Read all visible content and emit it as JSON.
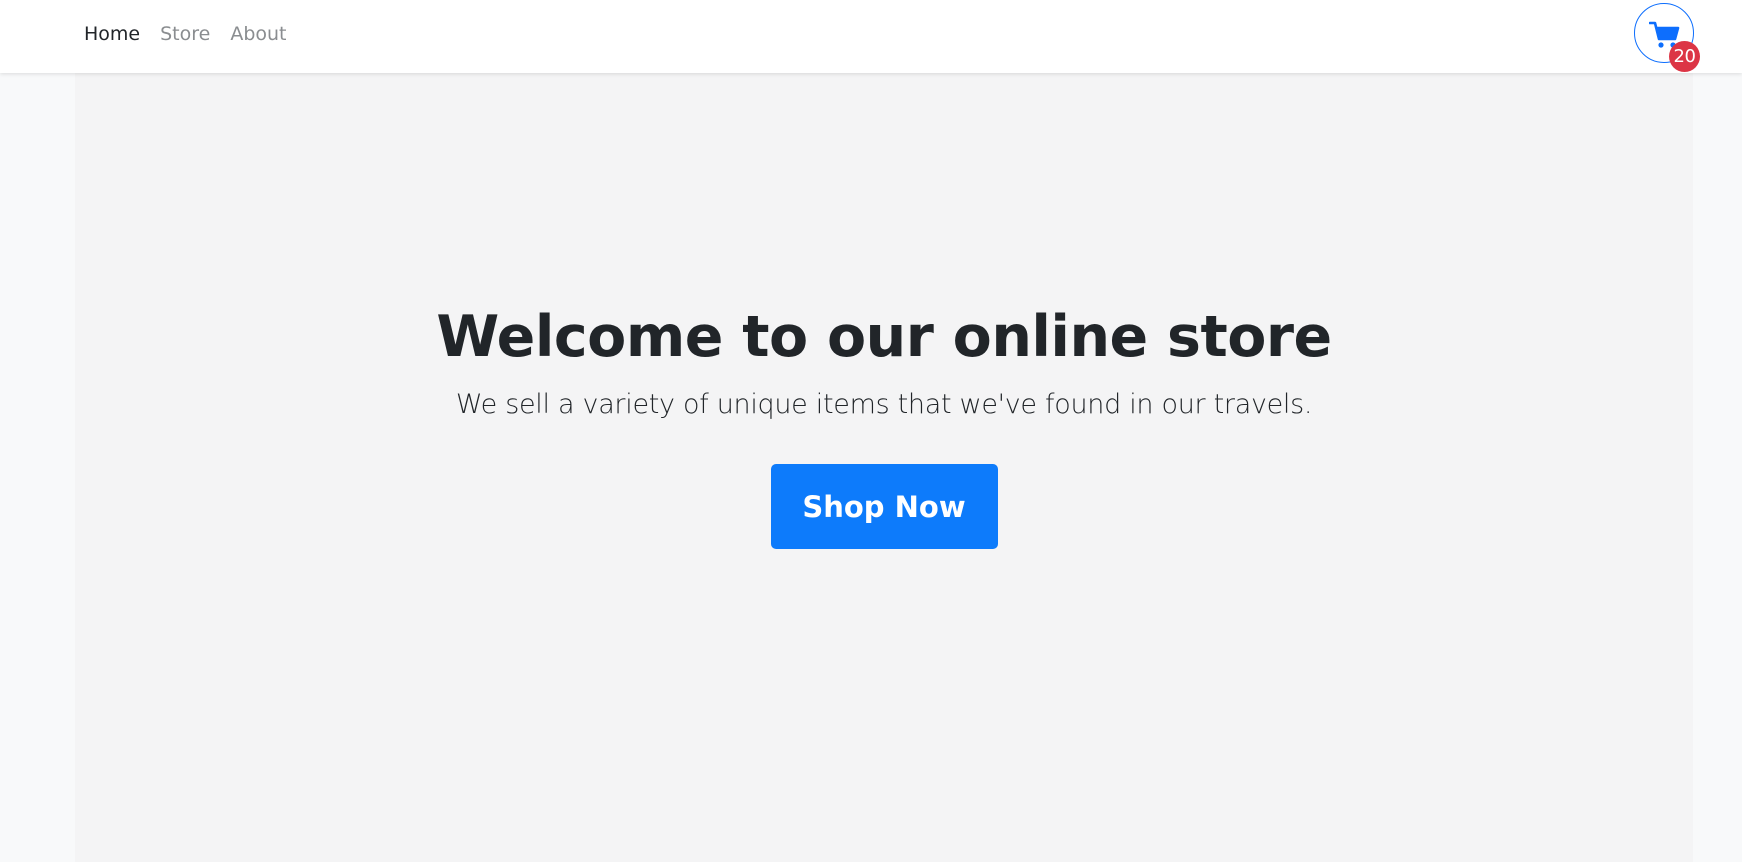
{
  "nav": {
    "items": [
      {
        "label": "Home",
        "active": true
      },
      {
        "label": "Store",
        "active": false
      },
      {
        "label": "About",
        "active": false
      }
    ]
  },
  "cart": {
    "icon": "cart-icon",
    "count": "20",
    "badge_color": "#dc3545",
    "accent_color": "#0d6efd"
  },
  "hero": {
    "title": "Welcome to our online store",
    "subtitle": "We sell a variety of unique items that we've found in our travels.",
    "cta_label": "Shop Now",
    "cta_color": "#0d7bfb"
  }
}
